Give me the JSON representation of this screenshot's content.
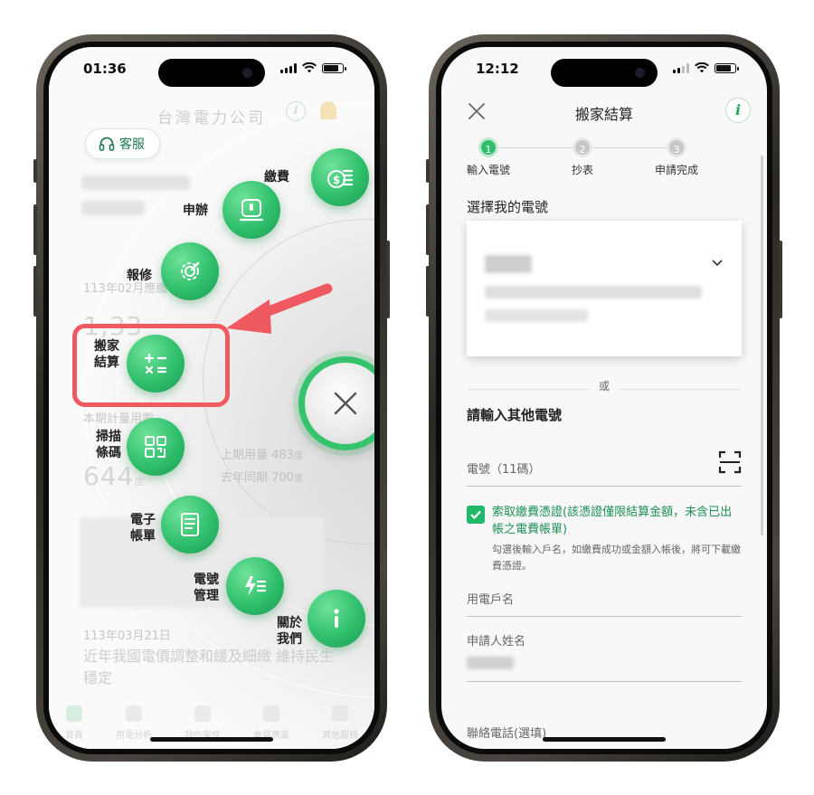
{
  "left_phone": {
    "status": {
      "time": "01:36"
    },
    "brand": "台灣電力公司",
    "service_button": {
      "label": "客服",
      "icon": "headset-icon"
    },
    "ghost_text": {
      "date1": "113年02月應繳",
      "big_amount": "1,33",
      "usage_label": "本期計量用電",
      "usage_value": "644",
      "usage_unit": "度",
      "prev_period": "上期用量 483",
      "prev_unit": "度",
      "last_year": "去年同期 700",
      "last_year_unit": "度",
      "news_date": "113年03月21日",
      "news_title": "近年我國電價調整和緩及細緻 維持民生穩定"
    },
    "menu": [
      {
        "key": "pay",
        "label": "繳費",
        "icon": "coins-dollar-icon"
      },
      {
        "key": "apply",
        "label": "申辦",
        "icon": "monitor-apply-icon"
      },
      {
        "key": "repair",
        "label": "報修",
        "icon": "wrench-gear-icon"
      },
      {
        "key": "move",
        "label": "搬家結算",
        "label_line1": "搬家",
        "label_line2": "結算",
        "icon": "calculator-icon"
      },
      {
        "key": "scan",
        "label": "掃描條碼",
        "label_line1": "掃描",
        "label_line2": "條碼",
        "icon": "qr-scan-icon"
      },
      {
        "key": "ebill",
        "label": "電子帳單",
        "label_line1": "電子",
        "label_line2": "帳單",
        "icon": "document-icon"
      },
      {
        "key": "manage",
        "label": "電號管理",
        "label_line1": "電號",
        "label_line2": "管理",
        "icon": "bolt-list-icon"
      },
      {
        "key": "about",
        "label": "關於我們",
        "label_line1": "關於",
        "label_line2": "我們",
        "icon": "info-icon"
      }
    ],
    "tabs": [
      {
        "label": "首頁",
        "active": true
      },
      {
        "label": "用電分析"
      },
      {
        "label": "我的案件"
      },
      {
        "label": "會員專區"
      },
      {
        "label": "其他服務"
      }
    ],
    "accent": "#2fbf6c",
    "highlight_color": "#ee5a5f"
  },
  "right_phone": {
    "status": {
      "time": "12:12"
    },
    "header": {
      "title": "搬家結算",
      "close_icon": "close-icon",
      "info_icon": "info-icon"
    },
    "steps": [
      {
        "num": "1",
        "label": "輸入電號",
        "active": true
      },
      {
        "num": "2",
        "label": "抄表"
      },
      {
        "num": "3",
        "label": "申請完成"
      }
    ],
    "select_title": "選擇我的電號",
    "or_text": "或",
    "other_title": "請輸入其他電號",
    "number_field": {
      "placeholder": "電號（11碼）"
    },
    "receipt": {
      "checked": true,
      "text": "索取繳費憑證(該憑證僅限結算金額，未含已出帳之電費帳單)",
      "hint": "勾選後輸入戶名，如繳費成功或金額入帳後，將可下載繳費憑證。"
    },
    "account_name_field": {
      "label": "用電戶名"
    },
    "applicant_field": {
      "label": "申請人姓名"
    },
    "phone_field": {
      "label": "聯絡電話(選填)"
    },
    "accent": "#2fbf6c"
  }
}
